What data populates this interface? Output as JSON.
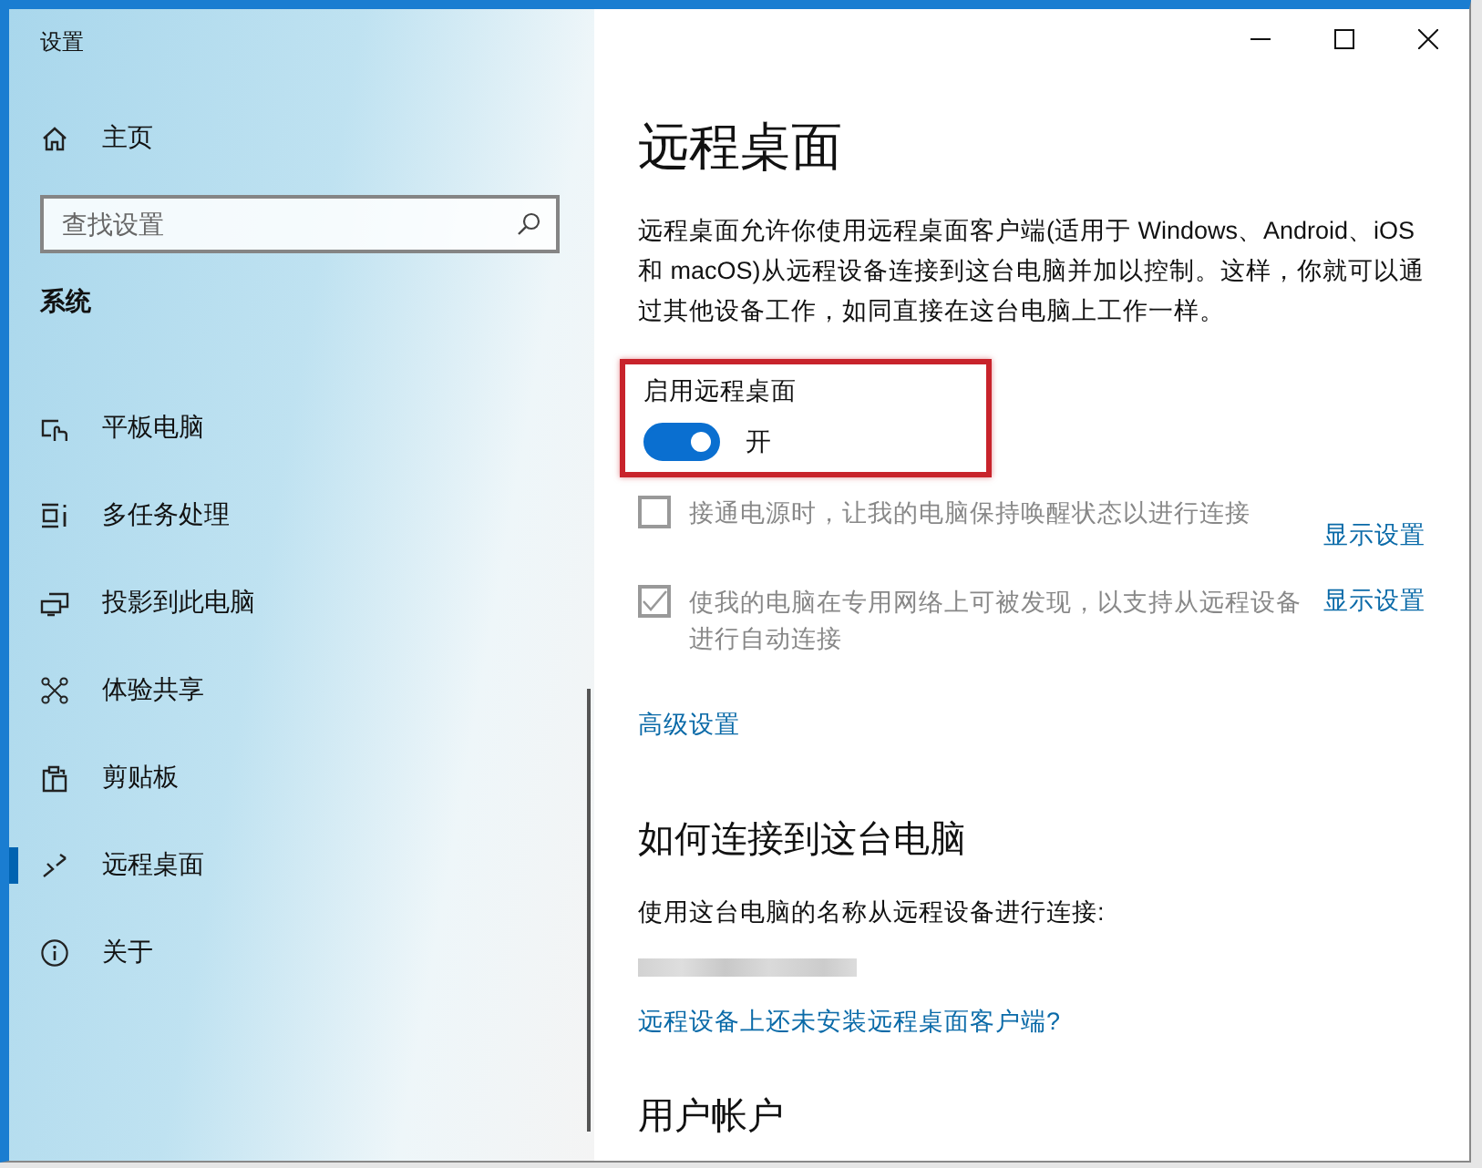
{
  "window": {
    "title": "设置"
  },
  "sidebar": {
    "home": "主页",
    "search": {
      "placeholder": "查找设置"
    },
    "section": "系统",
    "items": [
      {
        "label": "平板电脑",
        "selected": false
      },
      {
        "label": "多任务处理",
        "selected": false
      },
      {
        "label": "投影到此电脑",
        "selected": false
      },
      {
        "label": "体验共享",
        "selected": false
      },
      {
        "label": "剪贴板",
        "selected": false
      },
      {
        "label": "远程桌面",
        "selected": true
      },
      {
        "label": "关于",
        "selected": false
      }
    ]
  },
  "content": {
    "title": "远程桌面",
    "description": "远程桌面允许你使用远程桌面客户端(适用于 Windows、Android、iOS 和 macOS)从远程设备连接到这台电脑并加以控制。这样，你就可以通过其他设备工作，如同直接在这台电脑上工作一样。",
    "toggle": {
      "label": "启用远程桌面",
      "on": true,
      "state_text": "开",
      "highlighted": true
    },
    "options": [
      {
        "label": "接通电源时，让我的电脑保持唤醒状态以进行连接",
        "checked": false,
        "disabled": true,
        "link": "显示设置"
      },
      {
        "label": "使我的电脑在专用网络上可被发现，以支持从远程设备进行自动连接",
        "checked": true,
        "disabled": true,
        "link": "显示设置"
      }
    ],
    "advanced_link": "高级设置",
    "connect": {
      "heading": "如何连接到这台电脑",
      "instruction": "使用这台电脑的名称从远程设备进行连接:",
      "link": "远程设备上还未安装远程桌面客户端?"
    },
    "next_heading": "用户帐户"
  }
}
